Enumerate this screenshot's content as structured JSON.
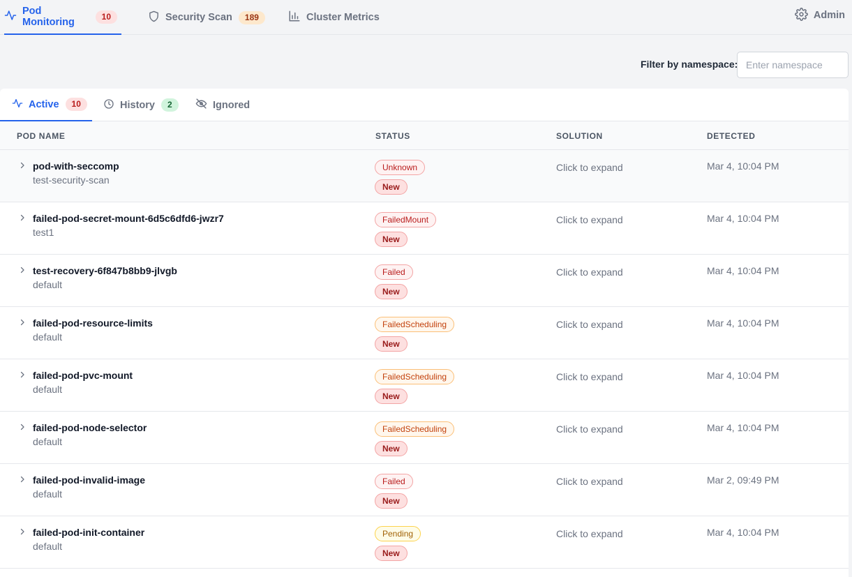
{
  "nav": {
    "tabs": [
      {
        "label": "Pod Monitoring",
        "badge": "10",
        "icon": "activity-icon"
      },
      {
        "label": "Security Scan",
        "badge": "189",
        "icon": "shield-icon"
      },
      {
        "label": "Cluster Metrics",
        "icon": "bar-chart-icon"
      }
    ],
    "admin_label": "Admin"
  },
  "filter": {
    "label": "Filter by namespace:",
    "placeholder": "Enter namespace"
  },
  "subtabs": [
    {
      "label": "Active",
      "badge": "10"
    },
    {
      "label": "History",
      "badge": "2"
    },
    {
      "label": "Ignored"
    }
  ],
  "table": {
    "headers": [
      "POD NAME",
      "STATUS",
      "SOLUTION",
      "DETECTED"
    ],
    "rows": [
      {
        "name": "pod-with-seccomp",
        "namespace": "test-security-scan",
        "status": "Unknown",
        "tag": "New",
        "solution": "Click to expand",
        "detected": "Mar 4, 10:04 PM"
      },
      {
        "name": "failed-pod-secret-mount-6d5c6dfd6-jwzr7",
        "namespace": "test1",
        "status": "FailedMount",
        "tag": "New",
        "solution": "Click to expand",
        "detected": "Mar 4, 10:04 PM"
      },
      {
        "name": "test-recovery-6f847b8bb9-jlvgb",
        "namespace": "default",
        "status": "Failed",
        "tag": "New",
        "solution": "Click to expand",
        "detected": "Mar 4, 10:04 PM"
      },
      {
        "name": "failed-pod-resource-limits",
        "namespace": "default",
        "status": "FailedScheduling",
        "tag": "New",
        "solution": "Click to expand",
        "detected": "Mar 4, 10:04 PM"
      },
      {
        "name": "failed-pod-pvc-mount",
        "namespace": "default",
        "status": "FailedScheduling",
        "tag": "New",
        "solution": "Click to expand",
        "detected": "Mar 4, 10:04 PM"
      },
      {
        "name": "failed-pod-node-selector",
        "namespace": "default",
        "status": "FailedScheduling",
        "tag": "New",
        "solution": "Click to expand",
        "detected": "Mar 4, 10:04 PM"
      },
      {
        "name": "failed-pod-invalid-image",
        "namespace": "default",
        "status": "Failed",
        "tag": "New",
        "solution": "Click to expand",
        "detected": "Mar 2, 09:49 PM"
      },
      {
        "name": "failed-pod-init-container",
        "namespace": "default",
        "status": "Pending",
        "tag": "New",
        "solution": "Click to expand",
        "detected": "Mar 4, 10:04 PM"
      }
    ]
  }
}
